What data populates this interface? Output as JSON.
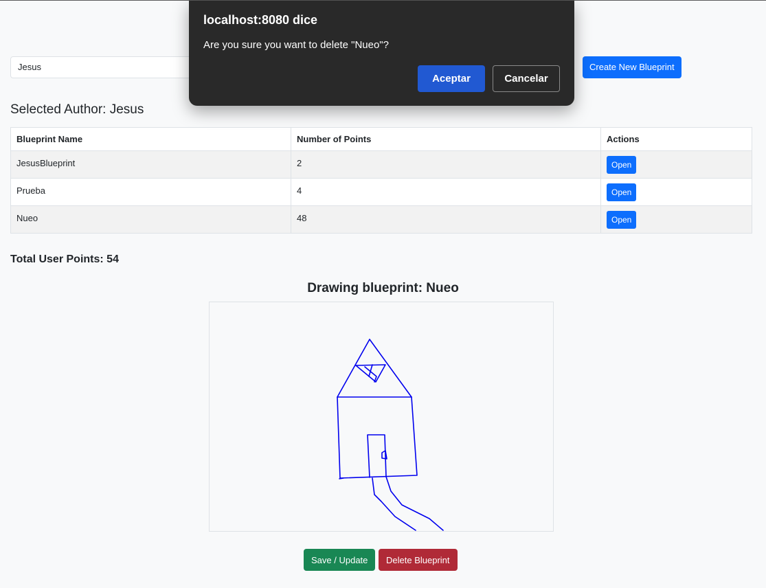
{
  "search": {
    "author_value": "Jesus"
  },
  "toolbar": {
    "create_label": "Create New Blueprint"
  },
  "selected_author": "Selected Author: Jesus",
  "table": {
    "headers": [
      "Blueprint Name",
      "Number of Points",
      "Actions"
    ],
    "rows": [
      {
        "name": "JesusBlueprint",
        "points": "2",
        "action": "Open"
      },
      {
        "name": "Prueba",
        "points": "4",
        "action": "Open"
      },
      {
        "name": "Nueo",
        "points": "48",
        "action": "Open"
      }
    ]
  },
  "total_points": "Total User Points: 54",
  "drawing": {
    "title": "Drawing blueprint: Nueo",
    "stroke_color": "#0000ee"
  },
  "actions": {
    "save_label": "Save / Update",
    "delete_label": "Delete Blueprint"
  },
  "dialog": {
    "title": "localhost:8080 dice",
    "message": "Are you sure you want to delete \"Nueo\"?",
    "ok_label": "Aceptar",
    "cancel_label": "Cancelar"
  },
  "colors": {
    "primary": "#0d6efd",
    "success": "#198754",
    "danger": "#b02a37",
    "dialog_bg": "#292929",
    "dialog_accent": "#2159d2"
  }
}
